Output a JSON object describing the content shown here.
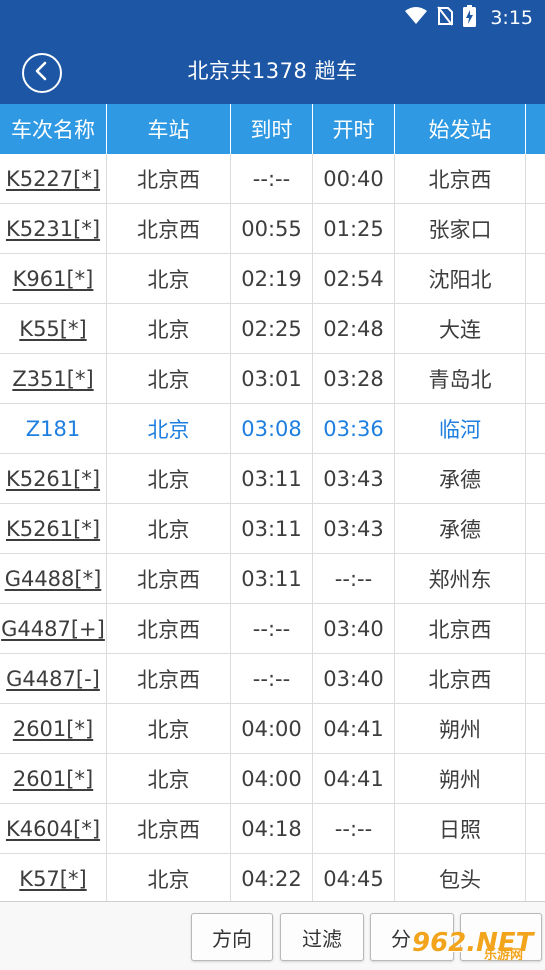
{
  "status_bar": {
    "time": "3:15",
    "icons": [
      "wifi-icon",
      "no-sim-icon",
      "battery-charging-icon"
    ]
  },
  "header": {
    "back_icon": "chevron-left-circle-icon",
    "title": "北京共1378 趟车"
  },
  "columns": [
    "车次名称",
    "车站",
    "到时",
    "开时",
    "始发站",
    ""
  ],
  "rows": [
    {
      "train": "K5227[*]",
      "station": "北京西",
      "arrive": "--:--",
      "depart": "00:40",
      "origin": "北京西",
      "extra": ""
    },
    {
      "train": "K5231[*]",
      "station": "北京西",
      "arrive": "00:55",
      "depart": "01:25",
      "origin": "张家口",
      "extra": ""
    },
    {
      "train": "K961[*]",
      "station": "北京",
      "arrive": "02:19",
      "depart": "02:54",
      "origin": "沈阳北",
      "extra": ""
    },
    {
      "train": "K55[*]",
      "station": "北京",
      "arrive": "02:25",
      "depart": "02:48",
      "origin": "大连",
      "extra": ""
    },
    {
      "train": "Z351[*]",
      "station": "北京",
      "arrive": "03:01",
      "depart": "03:28",
      "origin": "青岛北",
      "extra": ""
    },
    {
      "train": "Z181",
      "station": "北京",
      "arrive": "03:08",
      "depart": "03:36",
      "origin": "临河",
      "extra": "",
      "highlight": true
    },
    {
      "train": "K5261[*]",
      "station": "北京",
      "arrive": "03:11",
      "depart": "03:43",
      "origin": "承德",
      "extra": ""
    },
    {
      "train": "K5261[*]",
      "station": "北京",
      "arrive": "03:11",
      "depart": "03:43",
      "origin": "承德",
      "extra": ""
    },
    {
      "train": "G4488[*]",
      "station": "北京西",
      "arrive": "03:11",
      "depart": "--:--",
      "origin": "郑州东",
      "extra": ""
    },
    {
      "train": "G4487[+]",
      "station": "北京西",
      "arrive": "--:--",
      "depart": "03:40",
      "origin": "北京西",
      "extra": ""
    },
    {
      "train": "G4487[-]",
      "station": "北京西",
      "arrive": "--:--",
      "depart": "03:40",
      "origin": "北京西",
      "extra": ""
    },
    {
      "train": "2601[*]",
      "station": "北京",
      "arrive": "04:00",
      "depart": "04:41",
      "origin": "朔州",
      "extra": ""
    },
    {
      "train": "2601[*]",
      "station": "北京",
      "arrive": "04:00",
      "depart": "04:41",
      "origin": "朔州",
      "extra": ""
    },
    {
      "train": "K4604[*]",
      "station": "北京西",
      "arrive": "04:18",
      "depart": "--:--",
      "origin": "日照",
      "extra": ""
    },
    {
      "train": "K57[*]",
      "station": "北京",
      "arrive": "04:22",
      "depart": "04:45",
      "origin": "包头",
      "extra": ""
    }
  ],
  "footer": {
    "direction_label": "方向",
    "filter_label": "过滤",
    "share_label": "分",
    "watermark": "962.NET",
    "watermark_sub": "乐游网"
  },
  "colors": {
    "header_bg": "#1c56a4",
    "table_head_bg": "#2f9ae3",
    "highlight_text": "#1e7fe0"
  }
}
